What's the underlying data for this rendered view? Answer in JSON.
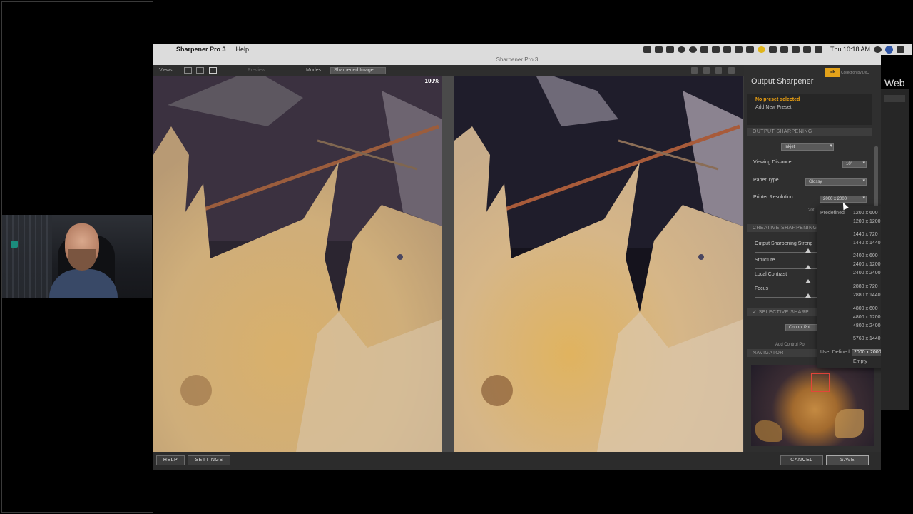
{
  "menubar": {
    "app_name": "Sharpener Pro 3",
    "help": "Help",
    "clock": "Thu 10:18 AM"
  },
  "window": {
    "title": "Sharpener Pro 3"
  },
  "toolbar": {
    "views_label": "Views:",
    "preview_label": "Preview:",
    "modes_label": "Modes:",
    "modes_value": "Sharpened Image",
    "zoom": "100%"
  },
  "panel": {
    "title": "Output Sharpener",
    "badge": "nik",
    "collection": "Collection by DxO",
    "no_preset": "No preset selected",
    "add_preset": "Add New Preset",
    "sec_output": "OUTPUT SHARPENING",
    "output_type": "Inkjet",
    "viewing_distance_label": "Viewing Distance",
    "viewing_distance_value": "10\"",
    "paper_type_label": "Paper Type",
    "paper_type_value": "Glossy",
    "printer_res_label": "Printer Resolution",
    "printer_res_value": "2000 x 2000",
    "printer_res_sub": "200",
    "sec_creative": "CREATIVE SHARPENING",
    "output_strength_label": "Output Sharpening Streng",
    "structure_label": "Structure",
    "local_contrast_label": "Local Contrast",
    "focus_label": "Focus",
    "sec_selective": "SELECTIVE SHARP",
    "control_points_label": "Control Poi",
    "add_control_label": "Add Control Poi",
    "sec_navigator": "NAVIGATOR"
  },
  "dropdown": {
    "predefined_label": "Predefined",
    "user_defined_label": "User Defined",
    "options": [
      "1200 x 600",
      "1200 x 1200",
      "1440 x 720",
      "1440 x 1440",
      "2400 x 600",
      "2400 x 1200",
      "2400 x 2400",
      "2880 x 720",
      "2880 x 1440",
      "4800 x 600",
      "4800 x 1200",
      "4800 x 2400",
      "5760 x 1440"
    ],
    "user_value": "2000 x 2000",
    "empty": "Empty"
  },
  "bottom": {
    "help": "HELP",
    "settings": "SETTINGS",
    "cancel": "CANCEL",
    "save": "SAVE"
  },
  "background": {
    "web_label": "Web"
  }
}
